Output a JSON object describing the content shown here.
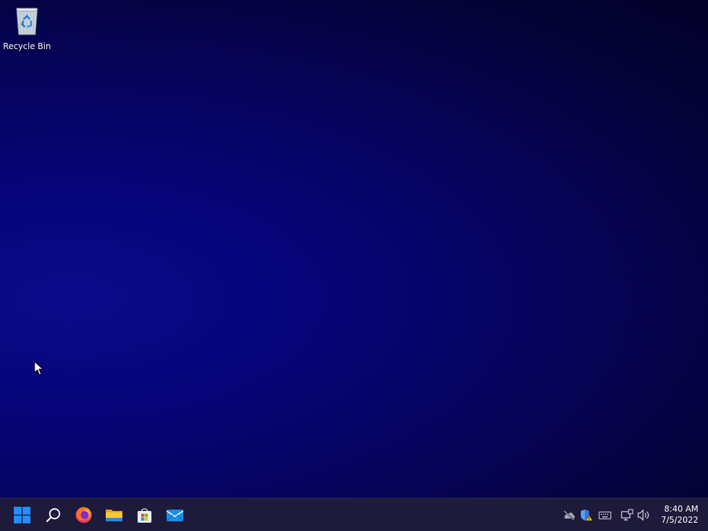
{
  "desktop": {
    "icons": [
      {
        "label": "Recycle Bin",
        "icon": "recycle-bin-icon"
      }
    ]
  },
  "taskbar": {
    "pinned": [
      {
        "name": "Start",
        "icon": "windows-logo-icon"
      },
      {
        "name": "Search",
        "icon": "search-icon"
      },
      {
        "name": "Firefox",
        "icon": "firefox-icon"
      },
      {
        "name": "File Explorer",
        "icon": "folder-icon"
      },
      {
        "name": "Microsoft Store",
        "icon": "store-icon"
      },
      {
        "name": "Mail",
        "icon": "mail-icon"
      }
    ],
    "tray": [
      {
        "name": "OneDrive",
        "icon": "cloud-offline-icon"
      },
      {
        "name": "Windows Security",
        "icon": "security-warning-icon"
      },
      {
        "name": "Touch Keyboard",
        "icon": "keyboard-icon"
      },
      {
        "name": "Network",
        "icon": "network-icon"
      },
      {
        "name": "Volume",
        "icon": "speaker-icon"
      }
    ],
    "clock": {
      "time": "8:40 AM",
      "date": "7/5/2022"
    }
  },
  "colors": {
    "taskbar_bg": "#1e1a3a",
    "windows_blue": "#1e90ff",
    "desktop_dark": "#030127"
  }
}
